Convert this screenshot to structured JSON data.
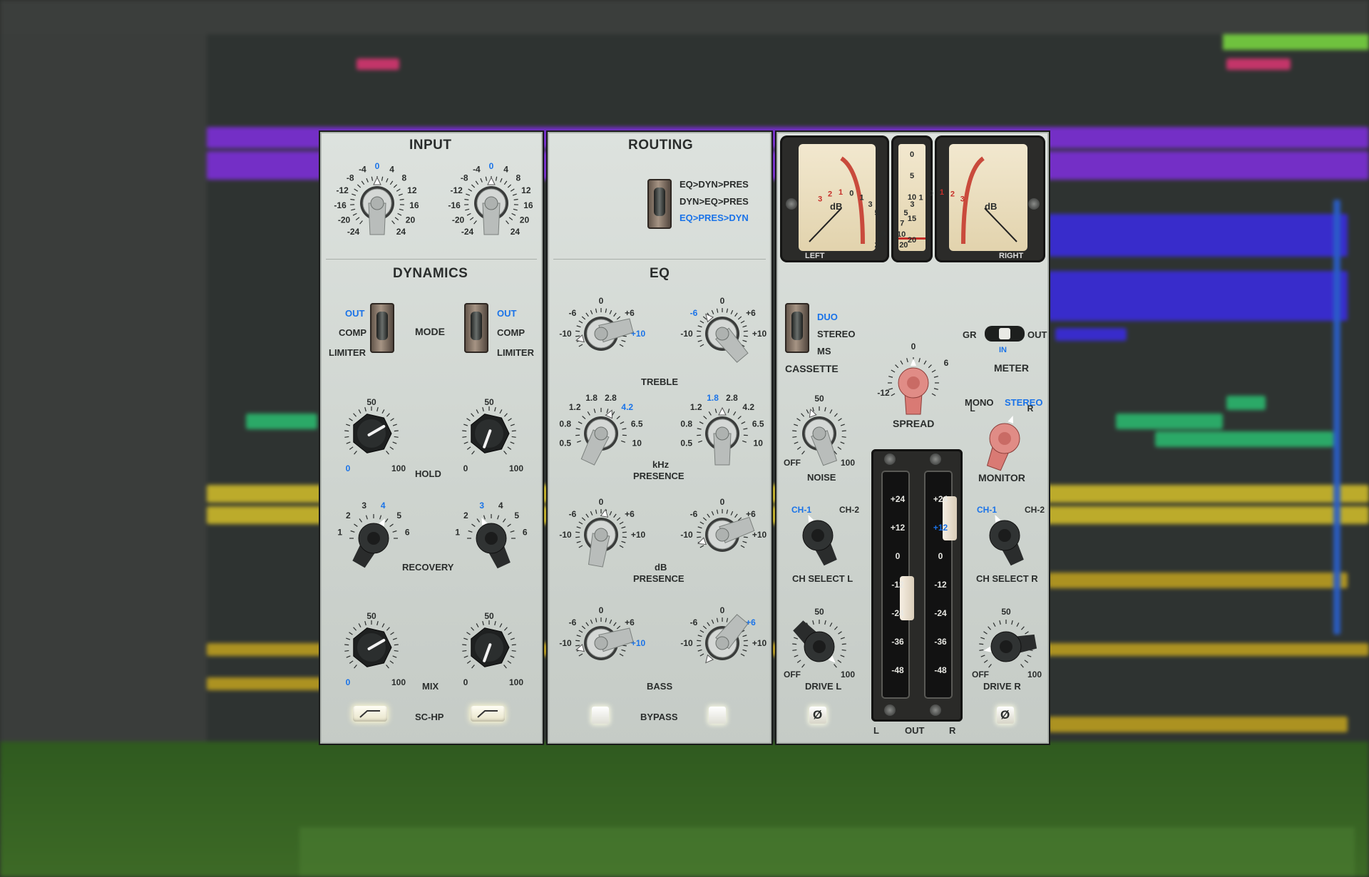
{
  "plugin": {
    "input": {
      "title": "INPUT",
      "scale": [
        "-4",
        "0",
        "4",
        "-8",
        "8",
        "-12",
        "12",
        "-16",
        "16",
        "-20",
        "20",
        "-24",
        "24"
      ]
    },
    "dynamics": {
      "title": "DYNAMICS",
      "mode": {
        "label": "MODE",
        "options": [
          "OUT",
          "COMP",
          "LIMITER"
        ],
        "selected": "OUT"
      },
      "hold": {
        "label": "HOLD",
        "min": "0",
        "mid": "50",
        "max": "100"
      },
      "recovery": {
        "label": "RECOVERY",
        "scale": [
          "1",
          "2",
          "3",
          "4",
          "5",
          "6"
        ],
        "left_value": "4",
        "right_value": "3"
      },
      "mix": {
        "label": "MIX",
        "min": "0",
        "mid": "50",
        "max": "100"
      },
      "sc_hp": {
        "label": "SC-HP"
      }
    },
    "routing": {
      "title": "ROUTING",
      "options": [
        "EQ>DYN>PRES",
        "DYN>EQ>PRES",
        "EQ>PRES>DYN"
      ],
      "selected": "EQ>PRES>DYN"
    },
    "eq": {
      "title": "EQ",
      "treble": {
        "label": "TREBLE",
        "scale": [
          "-6",
          "0",
          "+6",
          "-10",
          "+10"
        ],
        "left_value": "+10",
        "right_value": "-6"
      },
      "presence_khz": {
        "label1": "kHz",
        "label2": "PRESENCE",
        "scale": [
          "0.5",
          "0.8",
          "1.2",
          "1.8",
          "2.8",
          "4.2",
          "6.5",
          "10"
        ],
        "left_value": "4.2",
        "right_value": "1.8"
      },
      "presence_db": {
        "label1": "dB",
        "label2": "PRESENCE",
        "scale": [
          "-6",
          "0",
          "+6",
          "-10",
          "+10"
        ]
      },
      "bass": {
        "label": "BASS",
        "scale": [
          "-6",
          "0",
          "+6",
          "-10",
          "+10"
        ],
        "left_value": "+10",
        "right_value": "+6"
      },
      "bypass": {
        "label": "BYPASS"
      }
    },
    "output": {
      "vu": {
        "left_label": "LEFT",
        "right_label": "RIGHT",
        "unit": "dB",
        "scale": [
          "20",
          "10",
          "7",
          "5",
          "3",
          "1",
          "0",
          "1",
          "2",
          "3"
        ],
        "center_scale": [
          "0",
          "5",
          "10",
          "15",
          "20"
        ]
      },
      "cassette": {
        "label": "CASSETTE",
        "options": [
          "DUO",
          "STEREO",
          "MS"
        ],
        "selected": "DUO"
      },
      "spread": {
        "label": "SPREAD",
        "min": "-12",
        "mid": "0",
        "max": "6"
      },
      "meter": {
        "label": "METER",
        "left": "GR",
        "right": "OUT",
        "state": "IN"
      },
      "noise": {
        "label": "NOISE",
        "min": "OFF",
        "mid": "50",
        "max": "100"
      },
      "monitor": {
        "label": "MONITOR",
        "options": [
          "MONO",
          "STEREO"
        ],
        "l": "L",
        "r": "R",
        "selected": "STEREO"
      },
      "ch_select_l": {
        "label": "CH SELECT L",
        "options": [
          "CH-1",
          "CH-2"
        ],
        "selected": "CH-1"
      },
      "ch_select_r": {
        "label": "CH SELECT R",
        "options": [
          "CH-1",
          "CH-2"
        ],
        "selected": "CH-1"
      },
      "drive_l": {
        "label": "DRIVE L",
        "min": "OFF",
        "mid": "50",
        "max": "100"
      },
      "drive_r": {
        "label": "DRIVE R",
        "min": "OFF",
        "mid": "50",
        "max": "100"
      },
      "fader": {
        "scale": [
          "24",
          "12",
          "0",
          "12",
          "24",
          "36",
          "48"
        ],
        "left_value": "12",
        "right_value": "12",
        "out": "OUT",
        "l": "L",
        "r": "R"
      },
      "phase_symbol": "Ø"
    }
  },
  "colors": {
    "accent_blue": "#1a73e8",
    "clip_purple": "#7b2fd3",
    "clip_blue": "#3a2bd8",
    "clip_green": "#2bb36b",
    "clip_yellow": "#c9b52a",
    "clip_gold": "#b79a1f",
    "clip_pink": "#d0356e",
    "spread_knob": "#d97a74",
    "monitor_knob": "#d97a74"
  }
}
